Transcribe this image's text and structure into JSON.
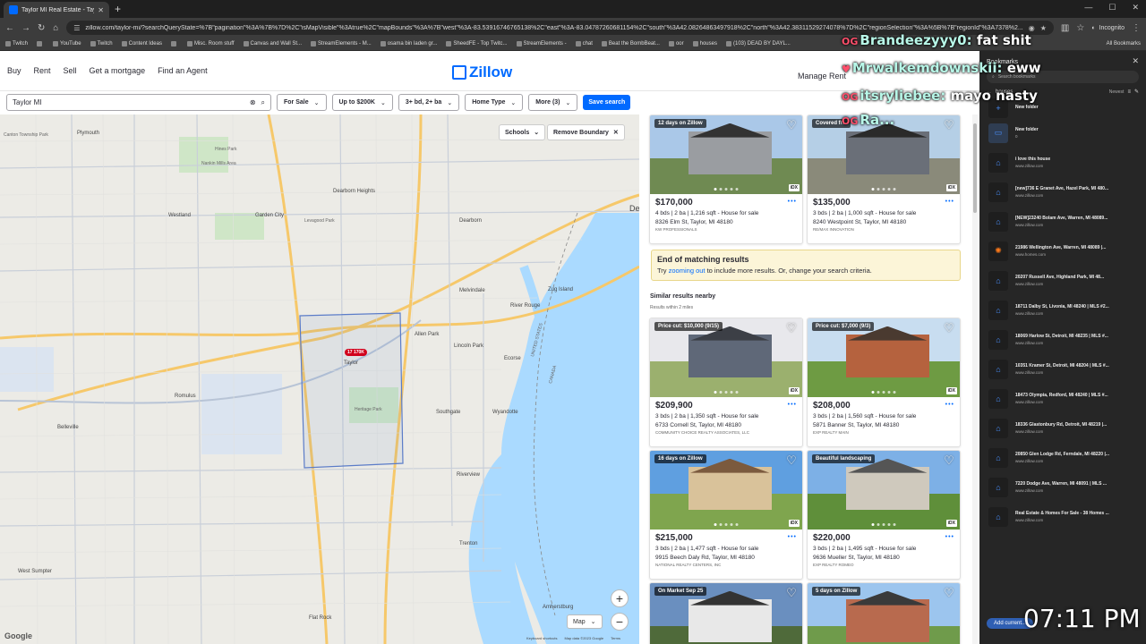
{
  "browser": {
    "tab_title": "Taylor MI Real Estate - Taylor M",
    "url": "zillow.com/taylor-mi/?searchQueryState=%7B\"pagination\"%3A%7B%7D%2C\"isMapVisible\"%3Atrue%2C\"mapBounds\"%3A%7B\"west\"%3A-83.53916746765138%2C\"east\"%3A-83.04787260681154%2C\"south\"%3A42.08264863497918%2C\"north\"%3A42.38311529274078%7D%2C\"regionSelection\"%3A%5B%7B\"regionId\"%3A7378%2...",
    "mode": "Incognito",
    "bookmarks": [
      "Twitch",
      "",
      "YouTube",
      "Twitch",
      "Content Ideas",
      "",
      "Misc. Room stuff",
      "Canvas and Wall St...",
      "StreamElements - M...",
      "osama bin laden gr...",
      "SheedFE - Top Twitc...",
      "StreamElements -",
      "chat",
      "Beat the BombBeat...",
      "oor",
      "houses",
      "(103) DEAD BY DAYL..."
    ],
    "all_bookmarks": "All Bookmarks"
  },
  "zillow": {
    "nav_left": [
      "Buy",
      "Rent",
      "Sell",
      "Get a mortgage",
      "Find an Agent"
    ],
    "logo": "Zillow",
    "nav_right": "Manage Rent",
    "search_value": "Taylor MI",
    "filters": [
      "For Sale",
      "Up to $200K",
      "3+ bd, 2+ ba",
      "Home Type",
      "More (3)"
    ],
    "save_search": "Save search",
    "map": {
      "schools": "Schools",
      "remove_boundary": "Remove Boundary",
      "pin": "17 170K",
      "map_type": "Map",
      "google": "Google",
      "attribution": [
        "Keyboard shortcuts",
        "Map data ©2023 Google",
        "Terms"
      ],
      "labels": [
        "Plymouth",
        "Canton Township Park",
        "Westland",
        "Garden City",
        "Dearborn Heights",
        "Dearborn",
        "Romulus",
        "Taylor",
        "Allen Park",
        "Lincoln Park",
        "Ecorse",
        "Southgate",
        "Wyandotte",
        "Riverview",
        "Belleville",
        "Trenton",
        "West Sumpter",
        "Flat Rock",
        "Amherstburg",
        "River Rouge",
        "Melvindale",
        "Zug Island",
        "UNITED STATES",
        "CANADA",
        "Hines Park",
        "Levagood Park",
        "Heritage Park",
        "Nankin Mills Area",
        "Det"
      ]
    },
    "listings": [
      {
        "badge": "12 days on Zillow",
        "price": "$170,000",
        "facts": "4 bds | 2 ba | 1,216 sqft - House for sale",
        "address": "8326 Elm St, Taylor, MI 48180",
        "broker": "KW PROFESSIONALS",
        "colors": [
          "#aac8e8",
          "#6f8a52",
          "#9a9da1",
          "#333"
        ]
      },
      {
        "badge": "Covered fr...",
        "price": "$135,000",
        "facts": "3 bds | 2 ba | 1,000 sqft - House for sale",
        "address": "8240 Westpoint St, Taylor, MI 48180",
        "broker": "RE/MAX INNOVATION",
        "colors": [
          "#b5cfe6",
          "#8a8a7a",
          "#6a6f78",
          "#2a2a2a"
        ]
      },
      {
        "badge": "Price cut: $10,000 (9/15)",
        "price": "$209,900",
        "facts": "3 bds | 2 ba | 1,350 sqft - House for sale",
        "address": "6733 Cornell St, Taylor, MI 48180",
        "broker": "COMMUNITY CHOICE REALTY ASSOCIATES, LLC",
        "colors": [
          "#e8e8ec",
          "#9bb06e",
          "#5f6878",
          "#3c3f46"
        ]
      },
      {
        "badge": "Price cut: $7,000 (9/3)",
        "price": "$208,000",
        "facts": "3 bds | 2 ba | 1,560 sqft - House for sale",
        "address": "5871 Banner St, Taylor, MI 48180",
        "broker": "EXP REALTY MAIN",
        "colors": [
          "#c8ddf0",
          "#6e9b43",
          "#b5623e",
          "#4a3a30"
        ]
      },
      {
        "badge": "16 days on Zillow",
        "price": "$215,000",
        "facts": "3 bds | 2 ba | 1,477 sqft - House for sale",
        "address": "9915 Beech Daly Rd, Taylor, MI 48180",
        "broker": "NATIONAL REALTY CENTERS, INC",
        "colors": [
          "#5f9fe0",
          "#7fa54e",
          "#d9c29a",
          "#7b5a3e"
        ]
      },
      {
        "badge": "Beautiful landscaping",
        "price": "$220,000",
        "facts": "3 bds | 2 ba | 1,495 sqft - House for sale",
        "address": "9636 Mueller St, Taylor, MI 48180",
        "broker": "EXP REALTY ROMEO",
        "colors": [
          "#7db0e6",
          "#5f8f3a",
          "#cfc9bd",
          "#555"
        ]
      },
      {
        "badge": "On Market Sep 25",
        "price": "",
        "facts": "",
        "address": "",
        "broker": "",
        "colors": [
          "#6a8fbf",
          "#4f6a3a",
          "#e8e8e8",
          "#333"
        ]
      },
      {
        "badge": "5 days on Zillow",
        "price": "",
        "facts": "",
        "address": "",
        "broker": "",
        "colors": [
          "#9cc5ee",
          "#6f9b4b",
          "#b86a4e",
          "#3a3a3a"
        ]
      }
    ],
    "end_title": "End of matching results",
    "end_text_pre": "Try ",
    "end_link": "zooming out",
    "end_text_post": " to include more results. Or, change your search criteria.",
    "similar_title": "Similar results nearby",
    "similar_sub": "Results within 2 miles"
  },
  "bookmarks_panel": {
    "title": "Bookmarks",
    "search_placeholder": "Search bookmarks",
    "folder": "houses",
    "sort": "Newest",
    "items": [
      {
        "title": "New folder",
        "url": "",
        "type": "new"
      },
      {
        "title": "New folder",
        "url": "0",
        "type": "folder"
      },
      {
        "title": "i love this house",
        "url": "www.zillow.com",
        "type": "z"
      },
      {
        "title": "[new]736 E Granet Ave, Hazel Park, MI 480...",
        "url": "www.zillow.com",
        "type": "z"
      },
      {
        "title": "[NEW]23240 Bolam Ave, Warren, MI 48089...",
        "url": "www.zillow.com",
        "type": "z"
      },
      {
        "title": "21986 Wellington Ave, Warren, MI 48089 |...",
        "url": "www.homes.com",
        "type": "h"
      },
      {
        "title": "20207 Russell Ave, Highland Park, MI 48...",
        "url": "www.zillow.com",
        "type": "z"
      },
      {
        "title": "18711 Dalby St, Livonia, MI 48240 | MLS #2...",
        "url": "www.zillow.com",
        "type": "z"
      },
      {
        "title": "18069 Harlow St, Detroit, MI 48235 | MLS #...",
        "url": "www.zillow.com",
        "type": "z"
      },
      {
        "title": "10351 Kramer St, Detroit, MI 48204 | MLS #...",
        "url": "www.zillow.com",
        "type": "z"
      },
      {
        "title": "18473 Olympia, Redford, MI 48240 | MLS #...",
        "url": "www.zillow.com",
        "type": "z"
      },
      {
        "title": "18336 Glastonbury Rd, Detroit, MI 48219 |...",
        "url": "www.zillow.com",
        "type": "z"
      },
      {
        "title": "20850 Glen Lodge Rd, Ferndale, MI 48220 |...",
        "url": "www.zillow.com",
        "type": "z"
      },
      {
        "title": "7220 Dodge Ave, Warren, MI 48091 | MLS ...",
        "url": "www.zillow.com",
        "type": "z"
      },
      {
        "title": "Real Estate & Homes For Sale - 38 Homes ...",
        "url": "www.zillow.com",
        "type": "z"
      }
    ],
    "add_button": "Add current..."
  },
  "overlay": {
    "chat": [
      {
        "user": "Brandeezyyy0:",
        "msg": " fat shit",
        "badge": "OG"
      },
      {
        "user": "Mrwalkemdownskii:",
        "msg": " eww",
        "badge": "♥"
      },
      {
        "user": "itsryliebee:",
        "msg": " mayo nasty",
        "badge": "OG"
      },
      {
        "user": "Ra...",
        "msg": "",
        "badge": "OG"
      }
    ],
    "clock": "07:11 PM"
  }
}
